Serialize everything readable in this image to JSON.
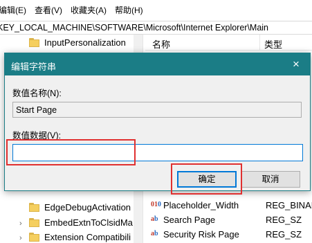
{
  "menu": [
    "编辑(E)",
    "查看(V)",
    "收藏夹(A)",
    "帮助(H)"
  ],
  "address": "KEY_LOCAL_MACHINE\\SOFTWARE\\Microsoft\\Internet Explorer\\Main",
  "tree_top": [
    {
      "label": "InputPersonalization"
    }
  ],
  "tree_bottom": [
    {
      "label": "EdgeDebugActivation"
    },
    {
      "label": "EmbedExtnToClsidMa"
    },
    {
      "label": "Extension Compatibili"
    }
  ],
  "list": {
    "header_name": "名称",
    "header_type": "类型",
    "rows": [
      {
        "name": "Placeholder_Width",
        "type": "REG_BINAR"
      },
      {
        "name": "Search Page",
        "type": "REG_SZ"
      },
      {
        "name": "Security Risk Page",
        "type": "REG_SZ"
      }
    ]
  },
  "dialog": {
    "title": "编辑字符串",
    "close": "×",
    "name_label": "数值名称(N):",
    "name_value": "Start Page",
    "data_label": "数值数据(V):",
    "data_value": "",
    "ok": "确定",
    "cancel": "取消"
  },
  "colors": {
    "titlebar": "#1b7d86",
    "annotation": "#e03030",
    "focus": "#0078d7"
  }
}
